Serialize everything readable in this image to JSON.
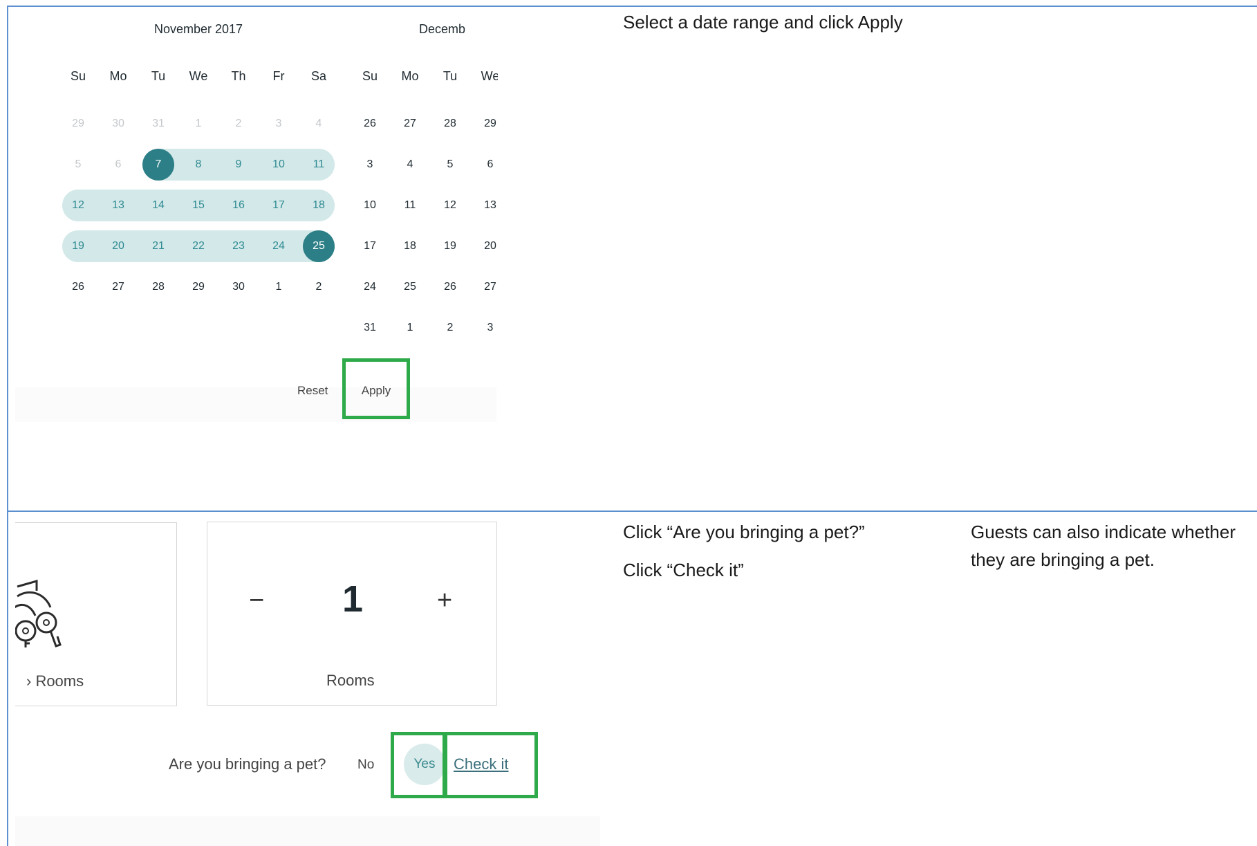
{
  "calendar": {
    "left_month": {
      "title": "November 2017",
      "weekdays": [
        "Su",
        "Mo",
        "Tu",
        "We",
        "Th",
        "Fr",
        "Sa"
      ],
      "weeks": [
        [
          {
            "d": "29",
            "s": "muted"
          },
          {
            "d": "30",
            "s": "muted"
          },
          {
            "d": "31",
            "s": "muted"
          },
          {
            "d": "1",
            "s": "muted"
          },
          {
            "d": "2",
            "s": "muted"
          },
          {
            "d": "3",
            "s": "muted"
          },
          {
            "d": "4",
            "s": "muted"
          }
        ],
        [
          {
            "d": "5",
            "s": "muted"
          },
          {
            "d": "6",
            "s": "muted"
          },
          {
            "d": "7",
            "s": "start"
          },
          {
            "d": "8",
            "s": "range"
          },
          {
            "d": "9",
            "s": "range"
          },
          {
            "d": "10",
            "s": "range"
          },
          {
            "d": "11",
            "s": "range"
          }
        ],
        [
          {
            "d": "12",
            "s": "range"
          },
          {
            "d": "13",
            "s": "range"
          },
          {
            "d": "14",
            "s": "range"
          },
          {
            "d": "15",
            "s": "range"
          },
          {
            "d": "16",
            "s": "range"
          },
          {
            "d": "17",
            "s": "range"
          },
          {
            "d": "18",
            "s": "range"
          }
        ],
        [
          {
            "d": "19",
            "s": "range"
          },
          {
            "d": "20",
            "s": "range"
          },
          {
            "d": "21",
            "s": "range"
          },
          {
            "d": "22",
            "s": "range"
          },
          {
            "d": "23",
            "s": "range"
          },
          {
            "d": "24",
            "s": "range"
          },
          {
            "d": "25",
            "s": "end"
          }
        ],
        [
          {
            "d": "26",
            "s": ""
          },
          {
            "d": "27",
            "s": ""
          },
          {
            "d": "28",
            "s": ""
          },
          {
            "d": "29",
            "s": ""
          },
          {
            "d": "30",
            "s": ""
          },
          {
            "d": "1",
            "s": ""
          },
          {
            "d": "2",
            "s": ""
          }
        ]
      ]
    },
    "right_month": {
      "title": "Decemb",
      "weekdays": [
        "Su",
        "Mo",
        "Tu",
        "We"
      ],
      "weeks": [
        [
          "26",
          "27",
          "28",
          "29"
        ],
        [
          "3",
          "4",
          "5",
          "6"
        ],
        [
          "10",
          "11",
          "12",
          "13"
        ],
        [
          "17",
          "18",
          "19",
          "20"
        ],
        [
          "24",
          "25",
          "26",
          "27"
        ],
        [
          "31",
          "1",
          "2",
          "3"
        ]
      ]
    },
    "reset_label": "Reset",
    "apply_label": "Apply",
    "range_color": "#d3e8e8",
    "endpoint_color": "#2c7f86"
  },
  "instructions": {
    "step1": "Select a date range and click Apply",
    "step2_line1": "Click “Are you bringing a pet?”",
    "step2_line2": "Click “Check it”",
    "note": "Guests can also indicate whether they are bringing a pet."
  },
  "rooms": {
    "left_card_label": "› Rooms",
    "left_card_icon": "keys-icon",
    "stepper_minus": "−",
    "stepper_plus": "+",
    "stepper_value": "1",
    "stepper_label": "Rooms"
  },
  "pet": {
    "question": "Are you bringing a pet?",
    "no_label": "No",
    "yes_label": "Yes",
    "check_label": "Check it"
  },
  "highlight_color": "#2eaa4a",
  "separator_color": "#5b8fd0"
}
